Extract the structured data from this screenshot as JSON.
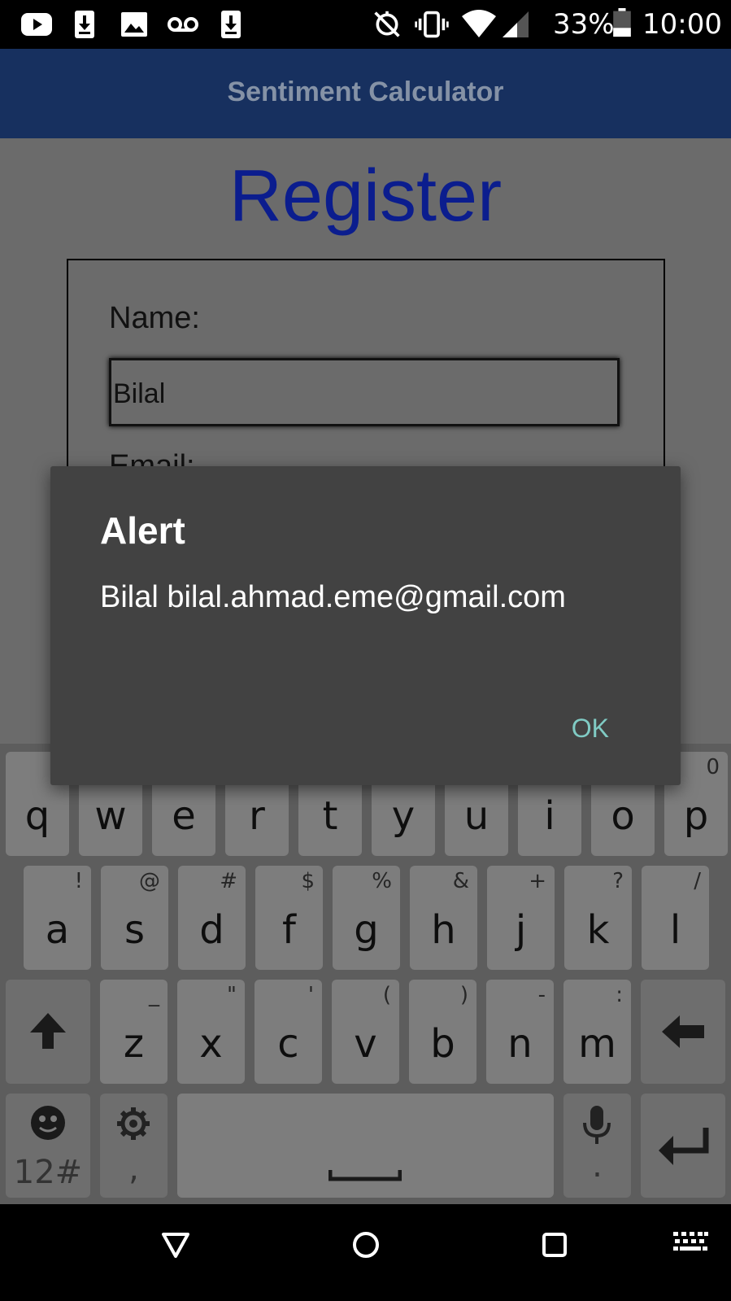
{
  "status_bar": {
    "battery": "33%",
    "time": "10:00"
  },
  "app_bar": {
    "title": "Sentiment Calculator"
  },
  "page": {
    "title": "Register",
    "name_label": "Name:",
    "name_value": "Bilal",
    "email_label": "Email:"
  },
  "dialog": {
    "title": "Alert",
    "message": "Bilal bilal.ahmad.eme@gmail.com",
    "ok_label": "OK"
  },
  "keyboard": {
    "row1": [
      {
        "key": "q",
        "hint": ""
      },
      {
        "key": "w",
        "hint": ""
      },
      {
        "key": "e",
        "hint": ""
      },
      {
        "key": "r",
        "hint": ""
      },
      {
        "key": "t",
        "hint": ""
      },
      {
        "key": "y",
        "hint": ""
      },
      {
        "key": "u",
        "hint": ""
      },
      {
        "key": "i",
        "hint": ""
      },
      {
        "key": "o",
        "hint": ""
      },
      {
        "key": "p",
        "hint": "0"
      }
    ],
    "row2": [
      {
        "key": "a",
        "hint": "!"
      },
      {
        "key": "s",
        "hint": "@"
      },
      {
        "key": "d",
        "hint": "#"
      },
      {
        "key": "f",
        "hint": "$"
      },
      {
        "key": "g",
        "hint": "%"
      },
      {
        "key": "h",
        "hint": "&"
      },
      {
        "key": "j",
        "hint": "+"
      },
      {
        "key": "k",
        "hint": "?"
      },
      {
        "key": "l",
        "hint": "/"
      }
    ],
    "row3": [
      {
        "key": "z",
        "hint": "_"
      },
      {
        "key": "x",
        "hint": "\""
      },
      {
        "key": "c",
        "hint": "'"
      },
      {
        "key": "v",
        "hint": "("
      },
      {
        "key": "b",
        "hint": ")"
      },
      {
        "key": "n",
        "hint": "-"
      },
      {
        "key": "m",
        "hint": ":"
      }
    ],
    "symbols_label": "12#",
    "comma_label": ",",
    "period_label": "."
  },
  "colors": {
    "app_bar": "#17305f",
    "title_blue": "#0b1d8e",
    "dialog_bg": "#424242",
    "ok_accent": "#80cbc4"
  },
  "icons": [
    "youtube-icon",
    "download-icon",
    "image-icon",
    "voicemail-icon",
    "download-icon",
    "auto-rotate-off-icon",
    "vibrate-icon",
    "wifi-icon",
    "signal-icon",
    "battery-icon",
    "shift-icon",
    "backspace-icon",
    "emoji-icon",
    "gear-icon",
    "mic-icon",
    "enter-icon",
    "back-icon",
    "home-icon",
    "recents-icon",
    "keyboard-icon"
  ]
}
